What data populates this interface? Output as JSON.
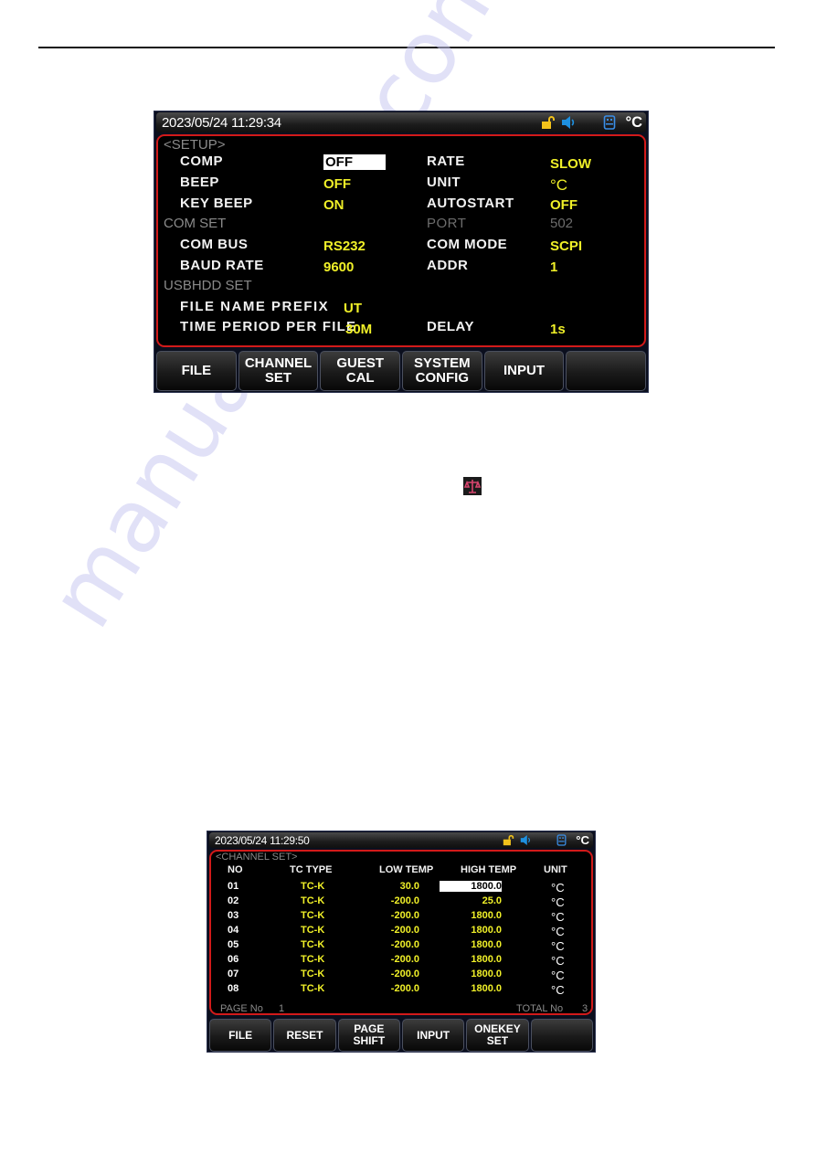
{
  "watermark": "manualshive.com",
  "screen_setup": {
    "status": {
      "datetime": "2023/05/24  11:29:34",
      "unit": "°C",
      "icons": [
        "lock-open-icon",
        "speaker-icon",
        "usb-disk-icon"
      ]
    },
    "section_title": "<SETUP>",
    "left_rows": [
      {
        "label": "COMP",
        "value": "OFF",
        "selected": true
      },
      {
        "label": "BEEP",
        "value": "OFF"
      },
      {
        "label": "KEY BEEP",
        "value": "ON"
      }
    ],
    "right_rows": [
      {
        "label": "RATE",
        "value": "SLOW"
      },
      {
        "label": "UNIT",
        "value": "°C"
      },
      {
        "label": "AUTOSTART",
        "value": "OFF"
      }
    ],
    "com_set": {
      "title": "COM SET",
      "port_label": "PORT",
      "port_value": "502",
      "com_bus_label": "COM BUS",
      "com_bus_value": "RS232",
      "baud_rate_label": "BAUD RATE",
      "baud_rate_value": "9600",
      "com_mode_label": "COM MODE",
      "com_mode_value": "SCPI",
      "addr_label": "ADDR",
      "addr_value": "1"
    },
    "usbhdd_set": {
      "title": "USBHDD SET",
      "prefix_label": "FILE NAME PREFIX",
      "prefix_value": "UT",
      "period_label": "TIME PERIOD PER FILE",
      "period_value": "30M",
      "delay_label": "DELAY",
      "delay_value": "1s"
    },
    "function_keys": [
      {
        "line1": "FILE",
        "line2": ""
      },
      {
        "line1": "CHANNEL",
        "line2": "SET"
      },
      {
        "line1": "GUEST",
        "line2": "CAL"
      },
      {
        "line1": "SYSTEM",
        "line2": "CONFIG"
      },
      {
        "line1": "INPUT",
        "line2": ""
      },
      {
        "line1": "",
        "line2": ""
      }
    ]
  },
  "inline_icon": "scale-icon",
  "screen_channel": {
    "status": {
      "datetime": "2023/05/24  11:29:50",
      "unit": "°C"
    },
    "section_title": "<CHANNEL SET>",
    "columns": [
      "NO",
      "TC TYPE",
      "LOW TEMP",
      "HIGH TEMP",
      "UNIT"
    ],
    "rows": [
      {
        "no": "01",
        "tc": "TC-K",
        "low": "30.0",
        "high": "1800.0",
        "unit": "°C",
        "selected": true
      },
      {
        "no": "02",
        "tc": "TC-K",
        "low": "-200.0",
        "high": "25.0",
        "unit": "°C"
      },
      {
        "no": "03",
        "tc": "TC-K",
        "low": "-200.0",
        "high": "1800.0",
        "unit": "°C"
      },
      {
        "no": "04",
        "tc": "TC-K",
        "low": "-200.0",
        "high": "1800.0",
        "unit": "°C"
      },
      {
        "no": "05",
        "tc": "TC-K",
        "low": "-200.0",
        "high": "1800.0",
        "unit": "°C"
      },
      {
        "no": "06",
        "tc": "TC-K",
        "low": "-200.0",
        "high": "1800.0",
        "unit": "°C"
      },
      {
        "no": "07",
        "tc": "TC-K",
        "low": "-200.0",
        "high": "1800.0",
        "unit": "°C"
      },
      {
        "no": "08",
        "tc": "TC-K",
        "low": "-200.0",
        "high": "1800.0",
        "unit": "°C"
      }
    ],
    "page_label": "PAGE No",
    "page_value": "1",
    "total_label": "TOTAL No",
    "total_value": "3",
    "function_keys": [
      {
        "line1": "FILE",
        "line2": ""
      },
      {
        "line1": "RESET",
        "line2": ""
      },
      {
        "line1": "PAGE",
        "line2": "SHIFT"
      },
      {
        "line1": "INPUT",
        "line2": ""
      },
      {
        "line1": "ONEKEY",
        "line2": "SET"
      },
      {
        "line1": "",
        "line2": ""
      }
    ]
  },
  "colors": {
    "frame_red": "#d21a1a",
    "value_yellow": "#f0f028",
    "dim_gray": "#6c6c6c",
    "lock_yellow": "#f2c21b",
    "icon_blue": "#1e90e0"
  }
}
